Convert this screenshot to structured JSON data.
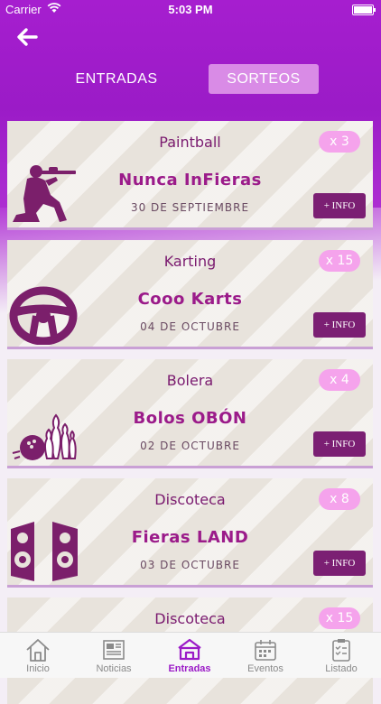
{
  "status": {
    "carrier": "Carrier",
    "time": "5:03 PM"
  },
  "tabs": {
    "entradas": "ENTRADAS",
    "sorteos": "SORTEOS",
    "active": "sorteos"
  },
  "cards": [
    {
      "category": "Paintball",
      "name": "Nunca InFieras",
      "date": "30 DE SEPTIEMBRE",
      "qty": "x 3",
      "info": "+ INFO",
      "icon": "paintball-player-icon"
    },
    {
      "category": "Karting",
      "name": "Cooo Karts",
      "date": "04 DE OCTUBRE",
      "qty": "x 15",
      "info": "+ INFO",
      "icon": "steering-wheel-icon"
    },
    {
      "category": "Bolera",
      "name": "Bolos OBÓN",
      "date": "02 DE OCTUBRE",
      "qty": "x 4",
      "info": "+ INFO",
      "icon": "bowling-icon"
    },
    {
      "category": "Discoteca",
      "name": "Fieras LAND",
      "date": "03 DE OCTUBRE",
      "qty": "x 8",
      "info": "+ INFO",
      "icon": "speakers-icon"
    },
    {
      "category": "Discoteca",
      "qty": "x 15"
    }
  ],
  "tabbar": [
    {
      "label": "Inicio",
      "icon": "home-icon"
    },
    {
      "label": "Noticias",
      "icon": "news-icon"
    },
    {
      "label": "Entradas",
      "icon": "tickets-icon",
      "active": true
    },
    {
      "label": "Eventos",
      "icon": "calendar-icon"
    },
    {
      "label": "Listado",
      "icon": "checklist-icon"
    }
  ],
  "colors": {
    "primary": "#9b1bc7",
    "accent": "#7b1f73",
    "badge": "#f5a3ec"
  }
}
